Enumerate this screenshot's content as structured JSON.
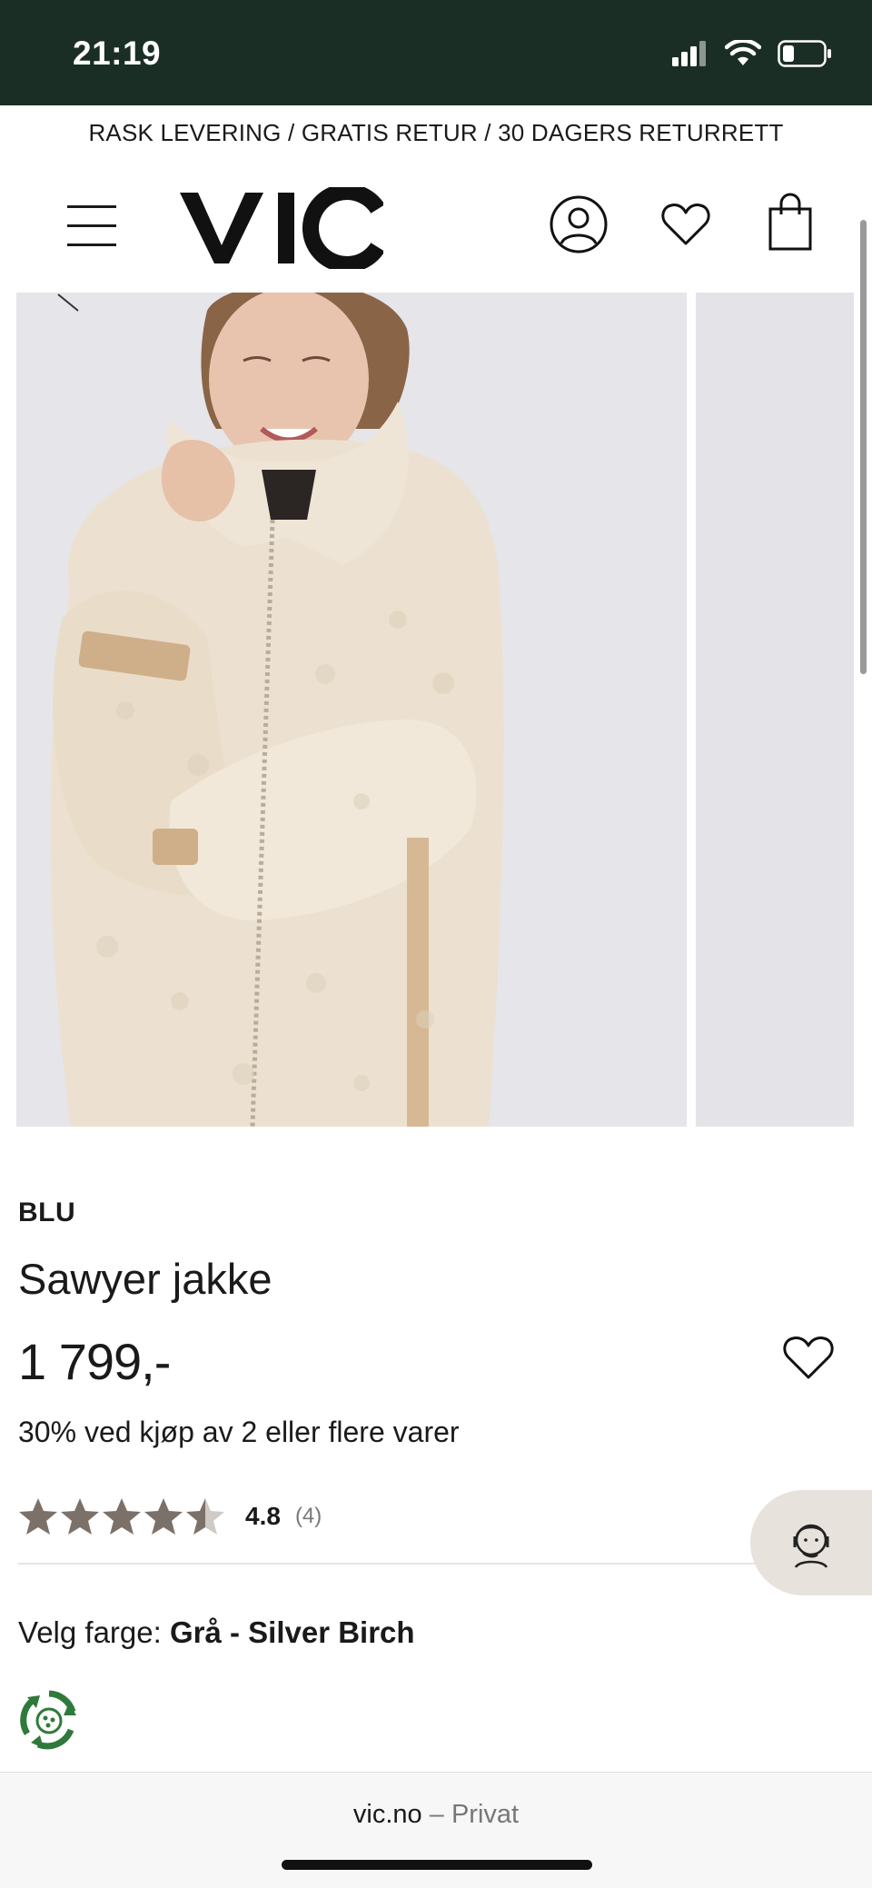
{
  "status_bar": {
    "time": "21:19"
  },
  "promo_banner": {
    "text": "RASK LEVERING / GRATIS RETUR / 30 DAGERS RETURRETT"
  },
  "header": {
    "logo": "VIC"
  },
  "product": {
    "brand": "BLU",
    "name": "Sawyer jakke",
    "price": "1 799,-",
    "promotion": "30% ved kjøp av 2 eller flere varer",
    "rating": {
      "value": "4.8",
      "count": "(4)",
      "stars": 4.5,
      "max_stars": 5
    },
    "color_label": "Velg farge:",
    "color_value": "Grå - Silver Birch"
  },
  "browser": {
    "domain": "vic.no",
    "separator": "–",
    "mode": "Privat"
  },
  "icons": {
    "menu": "hamburger-menu-icon",
    "account": "user-icon",
    "wishlist": "heart-icon",
    "cart": "shopping-bag-icon",
    "favorite": "heart-icon",
    "chat": "customer-service-icon",
    "eco": "recycle-icon"
  },
  "colors": {
    "status_bar_bg": "#1b2e26",
    "star": "#7c7168",
    "eco_green": "#2f7a3a",
    "chat_bg": "#e8e2dd"
  }
}
